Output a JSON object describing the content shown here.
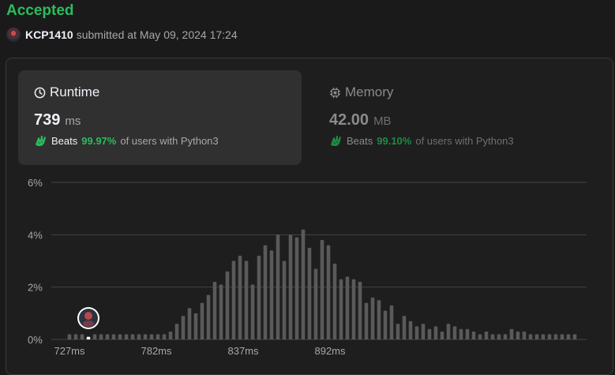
{
  "header": {
    "status": "Accepted",
    "username": "KCP1410",
    "submitted_text": "submitted at May 09, 2024 17:24"
  },
  "cards": {
    "runtime": {
      "title": "Runtime",
      "value": "739",
      "unit": "ms",
      "beats_label": "Beats",
      "beats_pct": "99.97%",
      "suffix": "of users with Python3",
      "icon": "clock-icon"
    },
    "memory": {
      "title": "Memory",
      "value": "42.00",
      "unit": "MB",
      "beats_label": "Beats",
      "beats_pct": "99.10%",
      "suffix": "of users with Python3",
      "icon": "chip-icon"
    }
  },
  "colors": {
    "accepted": "#2cbb5d",
    "bar": "#5a5a5a",
    "highlight_bar": "#ffffff",
    "grid": "#444444"
  },
  "chart_data": {
    "type": "bar",
    "xlabel": "",
    "ylabel": "",
    "ylim": [
      0,
      6
    ],
    "yticks": [
      "6%",
      "4%",
      "2%",
      "0%"
    ],
    "ytick_values": [
      6,
      4,
      2,
      0
    ],
    "xticks": [
      "727ms",
      "782ms",
      "837ms",
      "892ms"
    ],
    "xtick_values": [
      727,
      782,
      837,
      892
    ],
    "x": [
      727,
      731,
      735,
      739,
      743,
      747,
      751,
      755,
      759,
      763,
      767,
      771,
      775,
      779,
      783,
      787,
      791,
      795,
      799,
      803,
      807,
      811,
      815,
      819,
      823,
      827,
      831,
      835,
      839,
      843,
      847,
      851,
      855,
      859,
      863,
      867,
      871,
      875,
      879,
      883,
      887,
      891,
      895,
      899,
      903,
      907,
      911,
      915,
      919,
      923,
      927,
      931,
      935,
      939,
      943,
      947,
      951,
      955,
      959,
      963,
      967,
      971,
      975,
      979,
      983,
      987,
      991,
      995,
      999,
      1003,
      1007,
      1011,
      1015,
      1019,
      1023,
      1027,
      1031,
      1035,
      1039,
      1043,
      1047
    ],
    "values": [
      0.2,
      0.2,
      0.2,
      0.1,
      0.2,
      0.2,
      0.2,
      0.2,
      0.2,
      0.2,
      0.2,
      0.2,
      0.2,
      0.2,
      0.2,
      0.2,
      0.3,
      0.6,
      0.9,
      1.2,
      1.0,
      1.4,
      1.7,
      2.2,
      2.1,
      2.6,
      3.0,
      3.2,
      3.0,
      2.1,
      3.2,
      3.6,
      3.4,
      4.0,
      3.0,
      4.0,
      3.9,
      4.2,
      3.5,
      2.7,
      3.8,
      3.6,
      2.9,
      2.3,
      2.4,
      2.3,
      2.2,
      1.4,
      1.6,
      1.5,
      1.1,
      1.3,
      0.6,
      0.9,
      0.7,
      0.5,
      0.6,
      0.4,
      0.5,
      0.3,
      0.6,
      0.5,
      0.4,
      0.4,
      0.3,
      0.2,
      0.3,
      0.2,
      0.2,
      0.2,
      0.4,
      0.3,
      0.3,
      0.2,
      0.2,
      0.2,
      0.2,
      0.2,
      0.2,
      0.2,
      0.2
    ],
    "highlight_x": 739
  }
}
